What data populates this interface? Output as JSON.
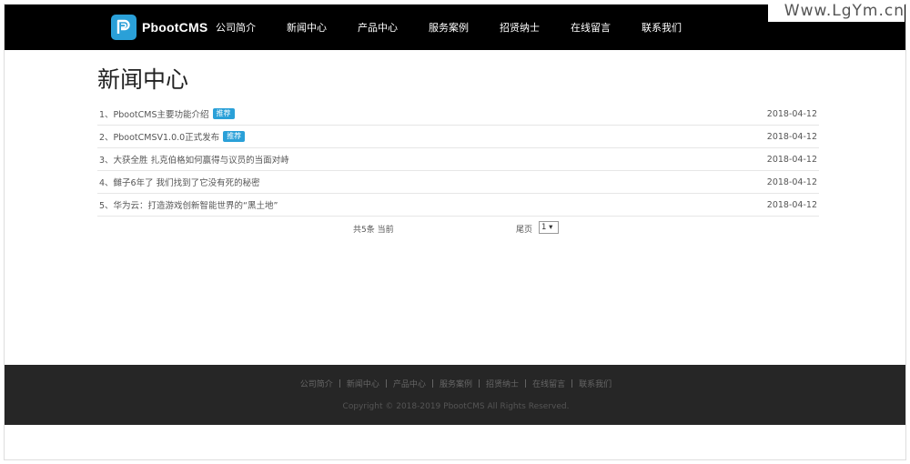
{
  "watermark": "Www.LgYm.cn",
  "brand": {
    "name": "PbootCMS",
    "logo_icon": "p-logo-icon",
    "logo_color": "#2aa0d8"
  },
  "nav": {
    "items": [
      {
        "label": "公司简介"
      },
      {
        "label": "新闻中心"
      },
      {
        "label": "产品中心"
      },
      {
        "label": "服务案例"
      },
      {
        "label": "招贤纳士"
      },
      {
        "label": "在线留言"
      },
      {
        "label": "联系我们"
      }
    ]
  },
  "page": {
    "title": "新闻中心"
  },
  "news": [
    {
      "title": "1、PbootCMS主要功能介绍",
      "badge": "推荐",
      "date": "2018-04-12"
    },
    {
      "title": "2、PbootCMSV1.0.0正式发布",
      "badge": "推荐",
      "date": "2018-04-12"
    },
    {
      "title": "3、大获全胜 扎克伯格如何赢得与议员的当面对峙",
      "badge": "",
      "date": "2018-04-12"
    },
    {
      "title": "4、雠子6年了 我们找到了它没有死的秘密",
      "badge": "",
      "date": "2018-04-12"
    },
    {
      "title": "5、华为云：打造游戏创新智能世界的“黑土地”",
      "badge": "",
      "date": "2018-04-12"
    }
  ],
  "pager": {
    "total": "共5条 当前",
    "last": "尾页",
    "select_value": "1 ▾"
  },
  "footer": {
    "links": [
      {
        "label": "公司简介"
      },
      {
        "label": "新闻中心"
      },
      {
        "label": "产品中心"
      },
      {
        "label": "服务案例"
      },
      {
        "label": "招贤纳士"
      },
      {
        "label": "在线留言"
      },
      {
        "label": "联系我们"
      }
    ],
    "separator": "|",
    "copyright": "Copyright © 2018-2019 PbootCMS All Rights Reserved."
  },
  "colors": {
    "navbar": "#000000",
    "accent": "#2aa0d8",
    "footer": "#262626"
  }
}
